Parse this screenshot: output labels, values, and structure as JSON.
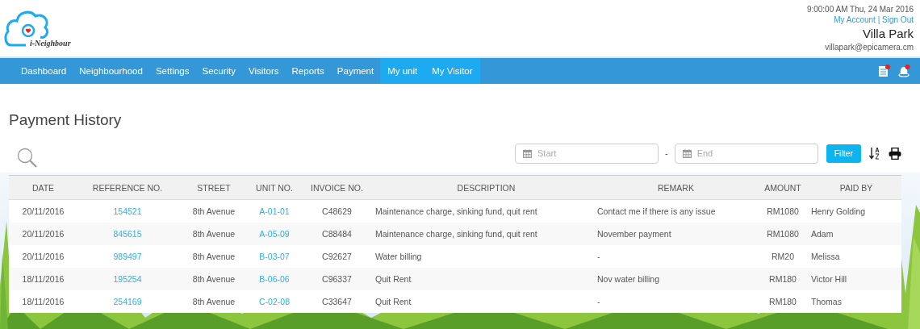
{
  "header": {
    "logo_text": "i-Neighbour",
    "datetime": "9:00:00 AM Thu, 24 Mar 2016",
    "account_link": "My Account",
    "separator": "|",
    "signout_link": "Sign Out",
    "user_name": "Villa Park",
    "user_email": "villapark@epicamera.cm"
  },
  "nav": [
    {
      "label": "Dashboard",
      "highlighted": false
    },
    {
      "label": "Neighbourhood",
      "highlighted": false
    },
    {
      "label": "Settings",
      "highlighted": false
    },
    {
      "label": "Security",
      "highlighted": false
    },
    {
      "label": "Visitors",
      "highlighted": false
    },
    {
      "label": "Reports",
      "highlighted": false
    },
    {
      "label": "Payment",
      "highlighted": false
    },
    {
      "label": "My unit",
      "highlighted": true
    },
    {
      "label": "My Visitor",
      "highlighted": true
    }
  ],
  "page_title": "Payment History",
  "filter": {
    "start_placeholder": "Start",
    "dash": "-",
    "end_placeholder": "End",
    "button": "Filter"
  },
  "table": {
    "columns": [
      {
        "label": "DATE",
        "kind": "text"
      },
      {
        "label": "REFERENCE NO.",
        "kind": "link"
      },
      {
        "label": "STREET",
        "kind": "text"
      },
      {
        "label": "UNIT NO.",
        "kind": "link"
      },
      {
        "label": "INVOICE NO.",
        "kind": "text"
      },
      {
        "label": "DESCRIPTION",
        "kind": "text"
      },
      {
        "label": "REMARK",
        "kind": "text"
      },
      {
        "label": "AMOUNT",
        "kind": "text"
      },
      {
        "label": "PAID BY",
        "kind": "text"
      }
    ],
    "rows": [
      [
        "20/11/2016",
        "154521",
        "8th Avenue",
        "A-01-01",
        "C48629",
        "Maintenance charge, sinking fund, quit rent",
        "Contact me if there is any issue",
        "RM1080",
        "Henry Golding"
      ],
      [
        "20/11/2016",
        "845615",
        "8th Avenue",
        "A-05-09",
        "C88484",
        "Maintenance charge, sinking fund, quit rent",
        "November payment",
        "RM1080",
        "Adam"
      ],
      [
        "20/11/2016",
        "989497",
        "8th Avenue",
        "B-03-07",
        "C92627",
        "Water billing",
        "-",
        "RM20",
        "Melissa"
      ],
      [
        "18/11/2016",
        "195254",
        "8th Avenue",
        "B-06-06",
        "C96337",
        "Quit Rent",
        "Nov water billing",
        "RM180",
        "Victor Hill"
      ],
      [
        "18/11/2016",
        "254169",
        "8th Avenue",
        "C-02-08",
        "C33647",
        "Quit Rent",
        "-",
        "RM180",
        "Thomas"
      ]
    ]
  }
}
